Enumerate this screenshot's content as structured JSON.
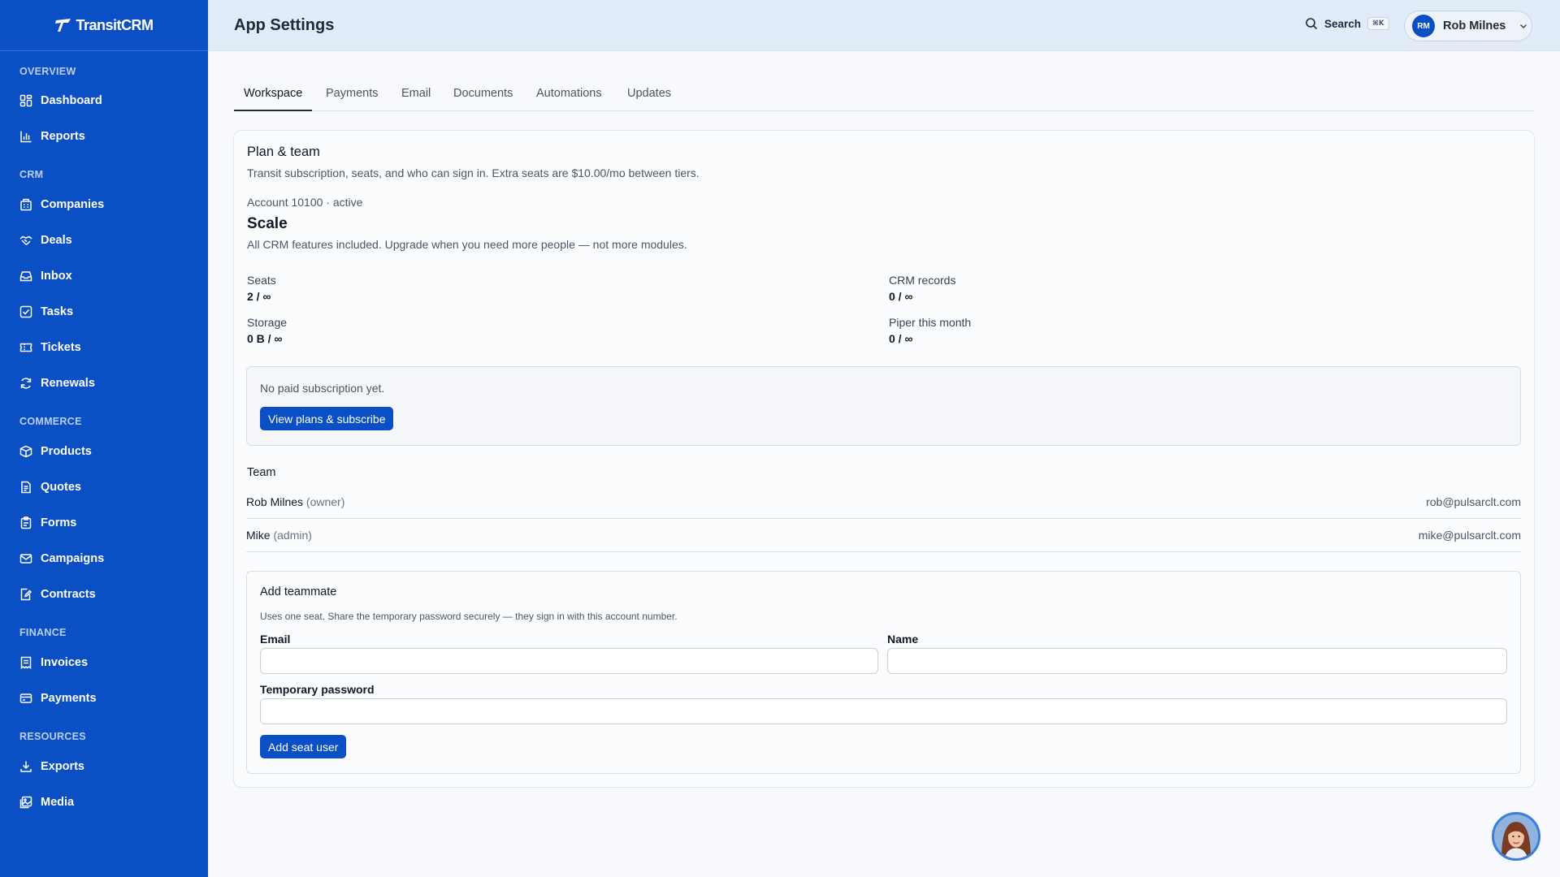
{
  "app": {
    "logo_text": "TransitCRM"
  },
  "sidebar": {
    "sections": [
      {
        "label": "OVERVIEW"
      },
      {
        "label": "CRM"
      },
      {
        "label": "COMMERCE"
      },
      {
        "label": "FINANCE"
      },
      {
        "label": "RESOURCES"
      }
    ],
    "items": [
      {
        "label": "Dashboard",
        "icon": "dashboard-icon"
      },
      {
        "label": "Reports",
        "icon": "bar-chart-icon"
      },
      {
        "label": "Companies",
        "icon": "building-icon"
      },
      {
        "label": "Deals",
        "icon": "handshake-icon"
      },
      {
        "label": "Inbox",
        "icon": "inbox-icon"
      },
      {
        "label": "Tasks",
        "icon": "checkbox-icon"
      },
      {
        "label": "Tickets",
        "icon": "ticket-icon"
      },
      {
        "label": "Renewals",
        "icon": "refresh-icon"
      },
      {
        "label": "Products",
        "icon": "package-icon"
      },
      {
        "label": "Quotes",
        "icon": "document-icon"
      },
      {
        "label": "Forms",
        "icon": "clipboard-icon"
      },
      {
        "label": "Campaigns",
        "icon": "mail-icon"
      },
      {
        "label": "Contracts",
        "icon": "contract-icon"
      },
      {
        "label": "Invoices",
        "icon": "invoice-icon"
      },
      {
        "label": "Payments",
        "icon": "credit-card-icon"
      },
      {
        "label": "Exports",
        "icon": "download-icon"
      },
      {
        "label": "Media",
        "icon": "image-icon"
      }
    ]
  },
  "header": {
    "title": "App Settings",
    "search_label": "Search",
    "search_shortcut": "⌘K",
    "user_initials": "RM",
    "user_name": "Rob Milnes"
  },
  "tabs": [
    {
      "label": "Workspace",
      "active": true
    },
    {
      "label": "Payments"
    },
    {
      "label": "Email"
    },
    {
      "label": "Documents"
    },
    {
      "label": "Automations"
    },
    {
      "label": "Updates"
    }
  ],
  "plan": {
    "section_title": "Plan & team",
    "description": "Transit subscription, seats, and who can sign in. Extra seats are $10.00/mo between tiers.",
    "account_line": "Account 10100 · active",
    "plan_name": "Scale",
    "plan_description": "All CRM features included. Upgrade when you need more people — not more modules.",
    "stats": [
      {
        "label": "Seats",
        "value": "2 / ∞"
      },
      {
        "label": "CRM records",
        "value": "0 / ∞"
      },
      {
        "label": "Storage",
        "value": "0 B / ∞"
      },
      {
        "label": "Piper this month",
        "value": "0 / ∞"
      }
    ],
    "subscription_status": "No paid subscription yet.",
    "subscribe_button": "View plans & subscribe"
  },
  "team": {
    "title": "Team",
    "members": [
      {
        "name": "Rob Milnes",
        "role": "(owner)",
        "email": "rob@pulsarclt.com"
      },
      {
        "name": "Mike",
        "role": "(admin)",
        "email": "mike@pulsarclt.com"
      }
    ]
  },
  "add_teammate": {
    "title": "Add teammate",
    "description": "Uses one seat. Share the temporary password securely — they sign in with this account number.",
    "email_label": "Email",
    "email_value": "",
    "name_label": "Name",
    "name_value": "",
    "password_label": "Temporary password",
    "password_value": "",
    "submit_button": "Add seat user"
  },
  "colors": {
    "brand": "#0b4fc4",
    "topbar": "#e2ecf8",
    "page_bg": "#f7f9fc"
  }
}
